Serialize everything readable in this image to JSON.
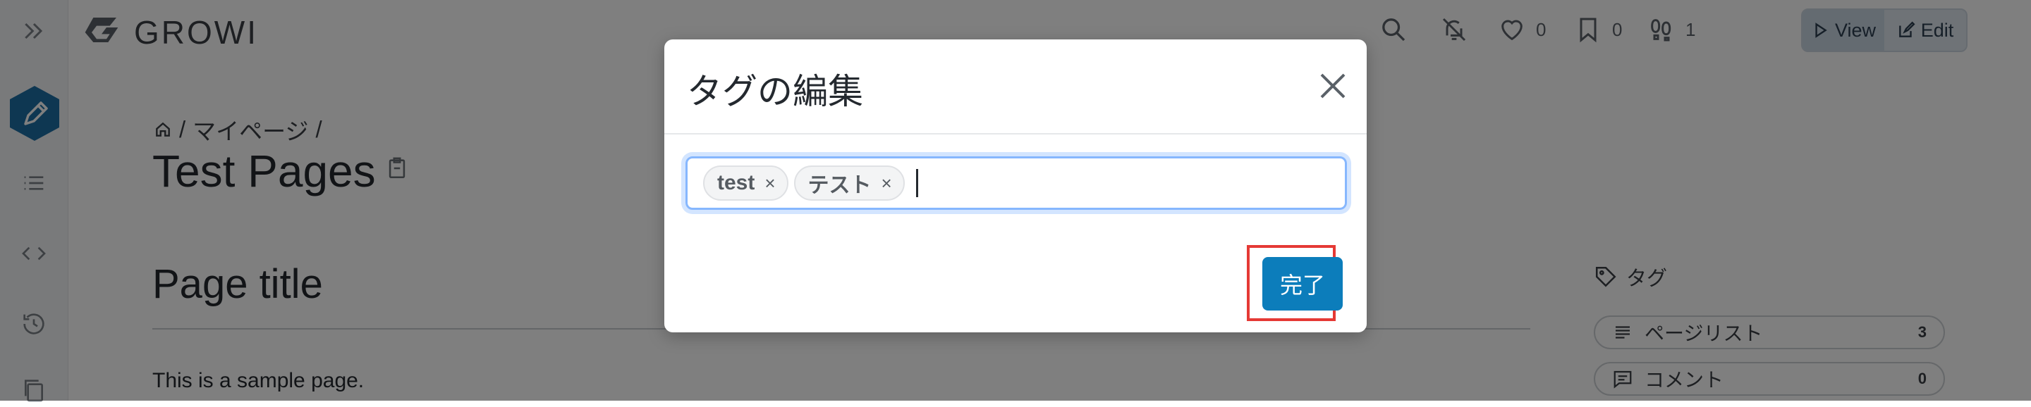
{
  "app": {
    "name": "GROWI"
  },
  "nav": {
    "like_count": "0",
    "bookmark_count": "0",
    "seen_count": "1",
    "view_label": "View",
    "edit_label": "Edit"
  },
  "page": {
    "breadcrumb": {
      "sep1": "/",
      "mypage": "マイページ",
      "sep2": "/"
    },
    "title": "Test Pages",
    "heading": "Page title",
    "paragraph": "This is a sample page."
  },
  "side": {
    "tag_label": "タグ",
    "items": [
      {
        "label": "ページリスト",
        "count": "3"
      },
      {
        "label": "コメント",
        "count": "0"
      }
    ]
  },
  "modal": {
    "title": "タグの編集",
    "tags": [
      "test",
      "テスト"
    ],
    "remove_glyph": "×",
    "done_label": "完了"
  },
  "colors": {
    "accent": "#0c7dbb",
    "highlight_frame": "#e53935",
    "focus_ring": "#86b7fe"
  },
  "icons": [
    "sidebar-toggle-icon",
    "growi-logo-icon",
    "pencil-icon",
    "list-icon",
    "code-icon",
    "history-icon",
    "copy-pages-icon",
    "search-icon",
    "bell-off-icon",
    "heart-icon",
    "bookmark-icon",
    "footprints-icon",
    "play-icon",
    "edit-icon",
    "home-icon",
    "clipboard-icon",
    "tag-icon",
    "close-icon"
  ]
}
